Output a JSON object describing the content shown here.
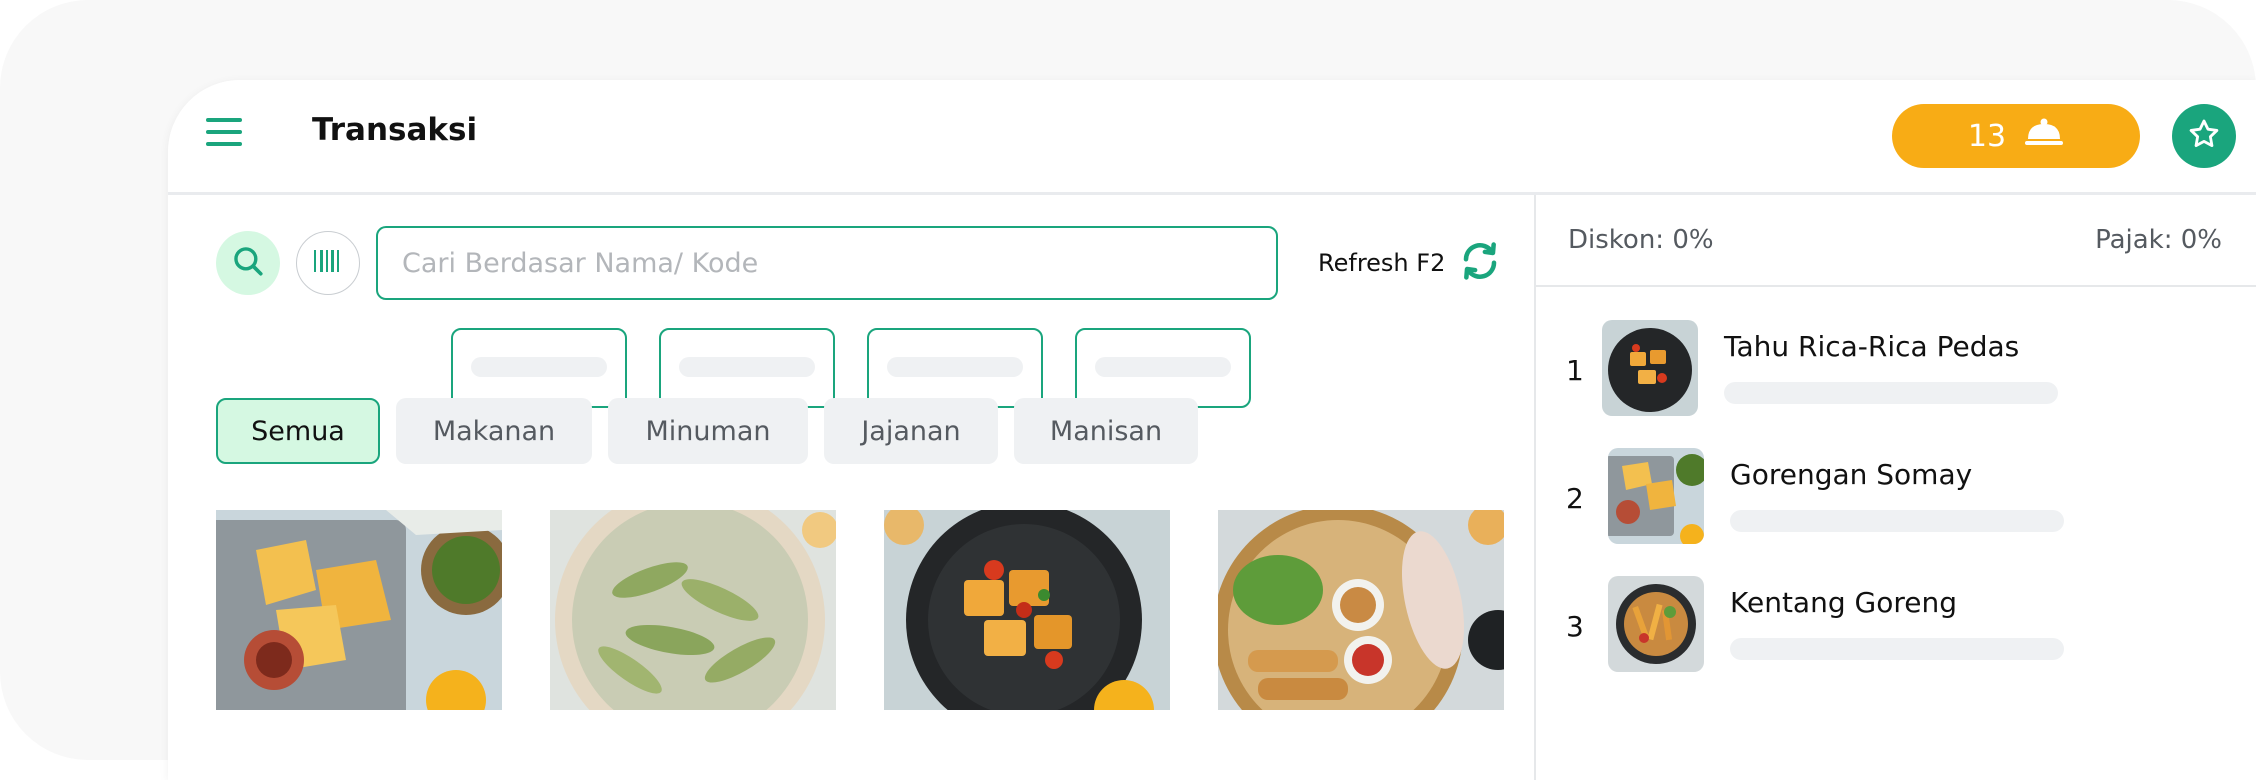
{
  "header": {
    "title": "Transaksi",
    "orders_count": "13",
    "colors": {
      "accent": "#1aa57d",
      "badge": "#f8ac15"
    }
  },
  "search": {
    "placeholder": "Cari Berdasar Nama/ Kode",
    "refresh_label": "Refresh F2"
  },
  "categories": [
    {
      "label": "Semua",
      "active": true
    },
    {
      "label": "Makanan",
      "active": false
    },
    {
      "label": "Minuman",
      "active": false
    },
    {
      "label": "Jajanan",
      "active": false
    },
    {
      "label": "Manisan",
      "active": false
    }
  ],
  "summary": {
    "discount": "Diskon: 0%",
    "tax": "Pajak: 0%"
  },
  "cart": [
    {
      "index": "1",
      "name": "Tahu Rica-Rica Pedas"
    },
    {
      "index": "2",
      "name": "Gorengan Somay"
    },
    {
      "index": "3",
      "name": "Kentang Goreng"
    }
  ]
}
